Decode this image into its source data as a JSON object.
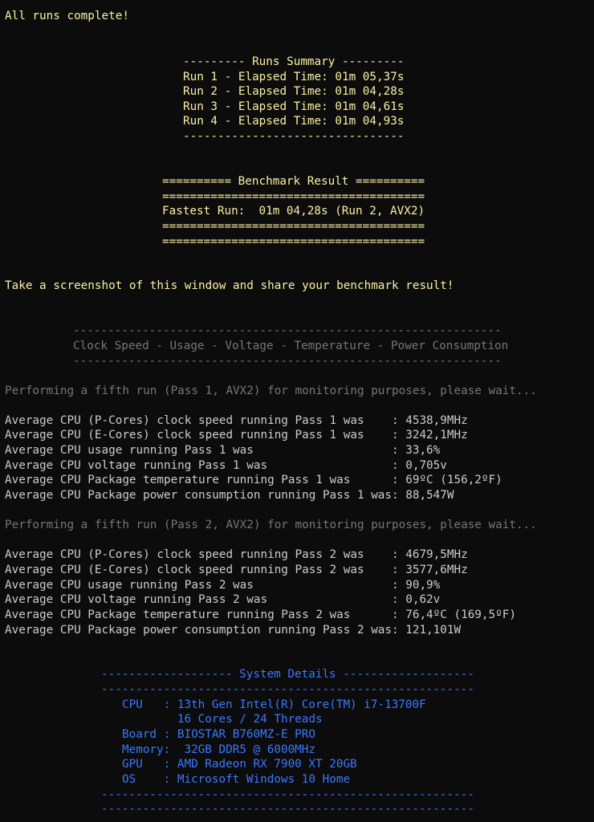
{
  "complete": "All runs complete!",
  "runs": {
    "header": "--------- Runs Summary ---------",
    "items": [
      "Run 1 - Elapsed Time: 01m 05,37s",
      "Run 2 - Elapsed Time: 01m 04,28s",
      "Run 3 - Elapsed Time: 01m 04,61s",
      "Run 4 - Elapsed Time: 01m 04,93s"
    ],
    "footer": "--------------------------------"
  },
  "benchmark": {
    "header": "========== Benchmark Result ==========",
    "sep": "======================================",
    "fastest": "Fastest Run:  01m 04,28s (Run 2, AVX2)"
  },
  "share": "Take a screenshot of this window and share your benchmark result!",
  "monitor": {
    "sep": "--------------------------------------------------------------",
    "title": "Clock Speed - Usage - Voltage - Temperature - Power Consumption"
  },
  "pass1": {
    "performing": "Performing a fifth run (Pass 1, AVX2) for monitoring purposes, please wait...",
    "lines": [
      "Average CPU (P-Cores) clock speed running Pass 1 was    : 4538,9MHz",
      "Average CPU (E-Cores) clock speed running Pass 1 was    : 3242,1MHz",
      "Average CPU usage running Pass 1 was                    : 33,6%",
      "Average CPU voltage running Pass 1 was                  : 0,705v",
      "Average CPU Package temperature running Pass 1 was      : 69ºC (156,2ºF)",
      "Average CPU Package power consumption running Pass 1 was: 88,547W"
    ]
  },
  "pass2": {
    "performing": "Performing a fifth run (Pass 2, AVX2) for monitoring purposes, please wait...",
    "lines": [
      "Average CPU (P-Cores) clock speed running Pass 2 was    : 4679,5MHz",
      "Average CPU (E-Cores) clock speed running Pass 2 was    : 3577,6MHz",
      "Average CPU usage running Pass 2 was                    : 90,9%",
      "Average CPU voltage running Pass 2 was                  : 0,62v",
      "Average CPU Package temperature running Pass 2 was      : 76,4ºC (169,5ºF)",
      "Average CPU Package power consumption running Pass 2 was: 121,101W"
    ]
  },
  "system": {
    "header": "------------------- System Details -------------------",
    "sep": "------------------------------------------------------",
    "cpu": "CPU   : 13th Gen Intel(R) Core(TM) i7-13700F",
    "cores": "        16 Cores / 24 Threads",
    "board": "Board : BIOSTAR B760MZ-E PRO",
    "memory": "Memory:  32GB DDR5 @ 6000MHz",
    "gpu": "GPU   : AMD Radeon RX 7900 XT 20GB",
    "os": "OS    : Microsoft Windows 10 Home"
  },
  "colors": {
    "background": "#0c0c0c",
    "yellow": "#f9f1a5",
    "gray": "#767676",
    "white": "#cccccc",
    "blue": "#3b78ff"
  }
}
